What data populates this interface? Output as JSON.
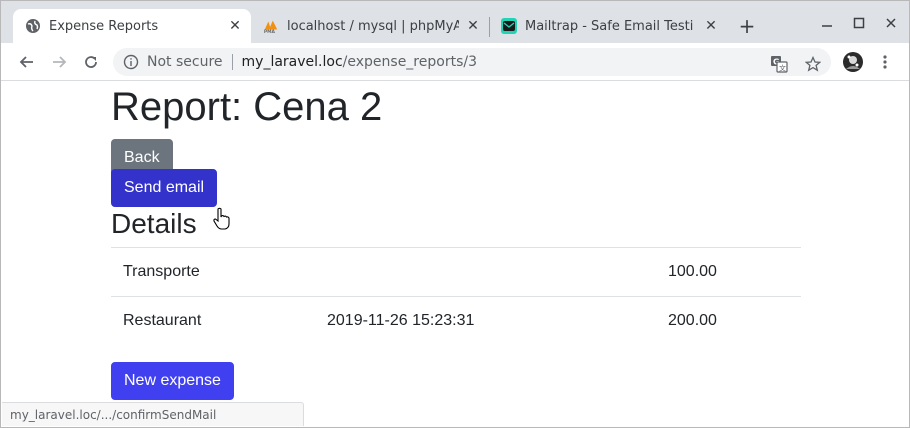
{
  "browser": {
    "tabs": [
      {
        "title": "Expense Reports",
        "icon": "globe-icon",
        "active": true
      },
      {
        "title": "localhost / mysql | phpMyA",
        "icon": "phpmyadmin-icon",
        "active": false
      },
      {
        "title": "Mailtrap - Safe Email Testi",
        "icon": "mailtrap-icon",
        "active": false
      }
    ],
    "tab_close_glyph": "✕",
    "new_tab_glyph": "+",
    "address": {
      "security_label": "Not secure",
      "host": "my_laravel.loc",
      "path": "/expense_reports/3"
    },
    "status_url": "my_laravel.loc/.../confirmSendMail"
  },
  "page": {
    "title": "Report: Cena 2",
    "back_label": "Back",
    "send_email_label": "Send email",
    "details_heading": "Details",
    "expenses": [
      {
        "description": "Transporte",
        "date": "",
        "amount": "100.00"
      },
      {
        "description": "Restaurant",
        "date": "2019-11-26 15:23:31",
        "amount": "200.00"
      }
    ],
    "new_expense_label": "New expense"
  },
  "colors": {
    "back_button": "#6c757d",
    "send_button": "#3333cc",
    "new_button": "#4040f0"
  }
}
